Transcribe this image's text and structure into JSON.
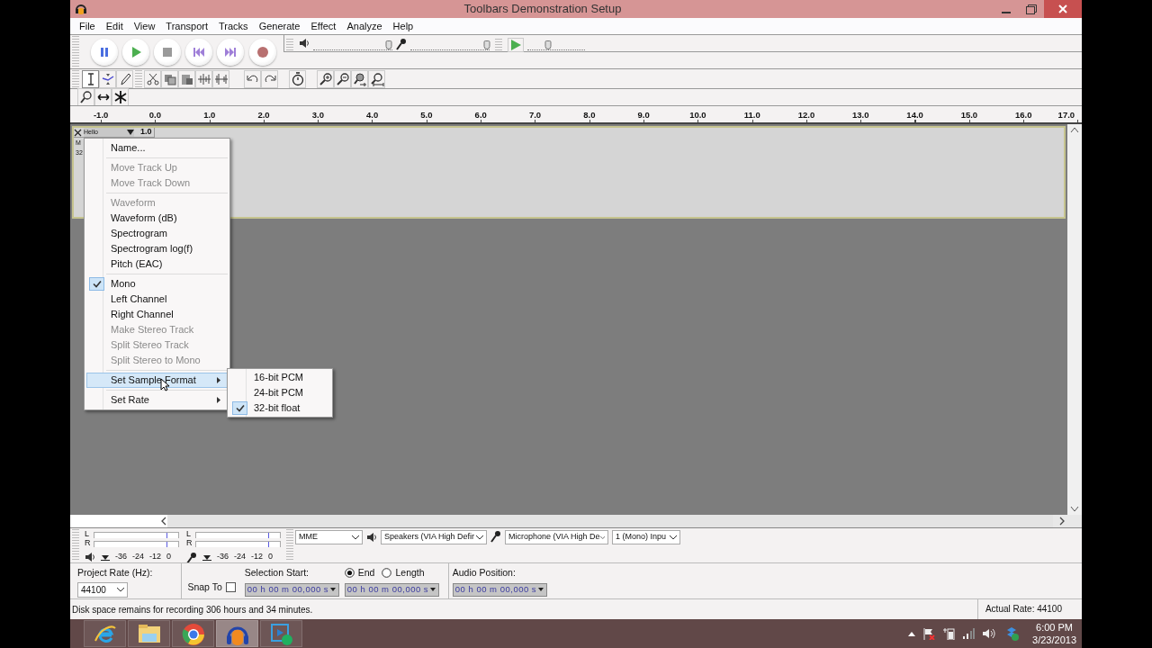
{
  "window": {
    "title": "Toolbars Demonstration Setup"
  },
  "menu_bar": [
    "File",
    "Edit",
    "View",
    "Transport",
    "Tracks",
    "Generate",
    "Effect",
    "Analyze",
    "Help"
  ],
  "transport_buttons": [
    {
      "kind": "pause"
    },
    {
      "kind": "play"
    },
    {
      "kind": "stop"
    },
    {
      "kind": "skip_start"
    },
    {
      "kind": "skip_end"
    },
    {
      "kind": "record"
    }
  ],
  "mixer": {
    "output_volume": {
      "level": 0.95
    },
    "input_volume": {
      "level": 0.97
    }
  },
  "play_at_speed": {
    "level": 0.35
  },
  "tools": [
    {
      "kind": "select",
      "selected": true
    },
    {
      "kind": "envelope",
      "selected": false
    },
    {
      "kind": "draw",
      "selected": false
    },
    {
      "kind": "zoom",
      "selected": false
    },
    {
      "kind": "timeshift",
      "selected": false
    },
    {
      "kind": "multi",
      "selected": false
    }
  ],
  "ruler": {
    "labels": [
      "-1.0",
      "0.0",
      "1.0",
      "2.0",
      "3.0",
      "4.0",
      "5.0",
      "6.0",
      "7.0",
      "8.0",
      "9.0",
      "10.0",
      "11.0",
      "12.0",
      "13.0",
      "14.0",
      "15.0",
      "16.0",
      "17.0"
    ]
  },
  "track": {
    "name": "Hello",
    "scale": "1.0",
    "info": [
      "M",
      "32"
    ]
  },
  "context_menu": {
    "groups": [
      [
        {
          "label": "Name...",
          "disabled": false,
          "checked": false,
          "submenu": false,
          "selected": false
        }
      ],
      [
        {
          "label": "Move Track Up",
          "disabled": true,
          "checked": false,
          "submenu": false,
          "selected": false
        },
        {
          "label": "Move Track Down",
          "disabled": true,
          "checked": false,
          "submenu": false,
          "selected": false
        }
      ],
      [
        {
          "label": "Waveform",
          "disabled": true,
          "checked": false,
          "submenu": false,
          "selected": false
        },
        {
          "label": "Waveform (dB)",
          "disabled": false,
          "checked": false,
          "submenu": false,
          "selected": false
        },
        {
          "label": "Spectrogram",
          "disabled": false,
          "checked": false,
          "submenu": false,
          "selected": false
        },
        {
          "label": "Spectrogram log(f)",
          "disabled": false,
          "checked": false,
          "submenu": false,
          "selected": false
        },
        {
          "label": "Pitch (EAC)",
          "disabled": false,
          "checked": false,
          "submenu": false,
          "selected": false
        }
      ],
      [
        {
          "label": "Mono",
          "disabled": false,
          "checked": true,
          "submenu": false,
          "selected": false
        },
        {
          "label": "Left Channel",
          "disabled": false,
          "checked": false,
          "submenu": false,
          "selected": false
        },
        {
          "label": "Right Channel",
          "disabled": false,
          "checked": false,
          "submenu": false,
          "selected": false
        },
        {
          "label": "Make Stereo Track",
          "disabled": true,
          "checked": false,
          "submenu": false,
          "selected": false
        },
        {
          "label": "Split Stereo Track",
          "disabled": true,
          "checked": false,
          "submenu": false,
          "selected": false
        },
        {
          "label": "Split Stereo to Mono",
          "disabled": true,
          "checked": false,
          "submenu": false,
          "selected": false
        }
      ],
      [
        {
          "label": "Set Sample Format",
          "disabled": false,
          "checked": false,
          "submenu": true,
          "selected": true
        }
      ],
      [
        {
          "label": "Set Rate",
          "disabled": false,
          "checked": false,
          "submenu": true,
          "selected": false
        }
      ]
    ]
  },
  "submenu": {
    "items": [
      {
        "label": "16-bit PCM",
        "checked": false
      },
      {
        "label": "24-bit PCM",
        "checked": false
      },
      {
        "label": "32-bit float",
        "checked": true
      }
    ]
  },
  "meter_toolbar": {
    "playback": {
      "channels": [
        "L",
        "R"
      ],
      "scale": [
        "-36",
        "-24",
        "-12",
        "0"
      ]
    },
    "recording": {
      "channels": [
        "L",
        "R"
      ],
      "scale": [
        "-36",
        "-24",
        "-12",
        "0"
      ]
    }
  },
  "device_toolbar": {
    "host": "MME",
    "output": "Speakers (VIA High Defir",
    "input": "Microphone (VIA High De",
    "channels": "1 (Mono) Inpu"
  },
  "selection_toolbar": {
    "project_rate_label": "Project Rate (Hz):",
    "project_rate": "44100",
    "snap_to": {
      "label": "Snap To",
      "checked": false
    },
    "selection_start_label": "Selection Start:",
    "end_length": [
      {
        "label": "End",
        "selected": true
      },
      {
        "label": "Length",
        "selected": false
      }
    ],
    "selection_times": [
      "00 h 00 m 00,000 s",
      "00 h 00 m 00,000 s"
    ],
    "audio_position_label": "Audio Position:",
    "audio_position": "00 h 00 m 00,000 s"
  },
  "status_bar": {
    "message": "Disk space remains for recording 306 hours and 34 minutes.",
    "actual_rate": "Actual Rate: 44100"
  },
  "taskbar": {
    "apps": [
      {
        "kind": "browser_e",
        "selected": false
      },
      {
        "kind": "folder",
        "selected": false
      },
      {
        "kind": "browser_ring",
        "selected": false
      },
      {
        "kind": "audio",
        "selected": true
      },
      {
        "kind": "media",
        "selected": false
      }
    ],
    "clock": {
      "time": "6:00 PM",
      "date": "3/23/2013"
    }
  }
}
